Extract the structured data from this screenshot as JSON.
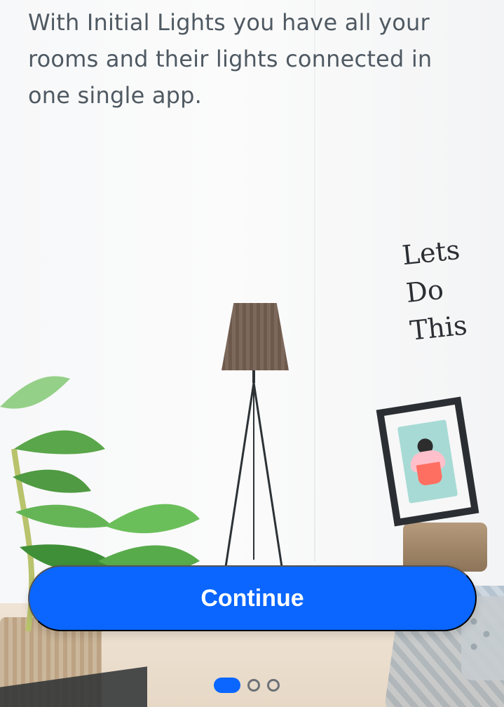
{
  "header": {
    "line1": "With Initial Lights you have all your",
    "line2": "rooms and their lights connected in",
    "line3": "one single app."
  },
  "cta": {
    "label": "Continue"
  },
  "pagination": {
    "current": 1,
    "total": 3
  },
  "colors": {
    "primary": "#0a66ff",
    "text": "#4f5962",
    "dot_border": "#6b7177"
  },
  "illustration": {
    "wall_text_line1": "Lets",
    "wall_text_line2": "Do",
    "wall_text_line3": "This"
  }
}
